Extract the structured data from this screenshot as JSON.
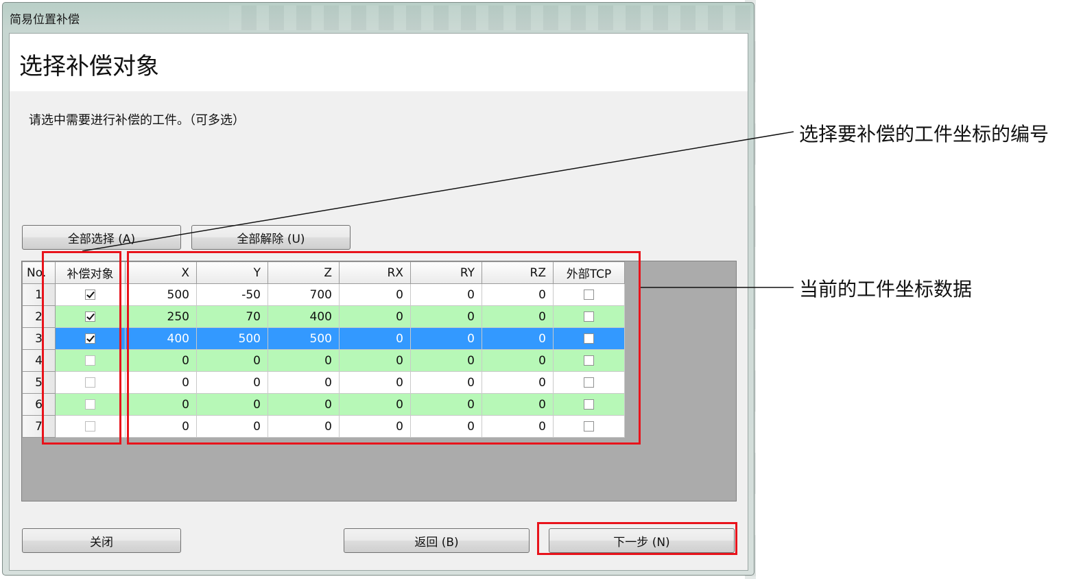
{
  "window": {
    "title": "简易位置补偿"
  },
  "page": {
    "heading": "选择补偿对象",
    "instruction": "请选中需要进行补偿的工件。（可多选）"
  },
  "buttons": {
    "select_all": "全部选择 (A)",
    "deselect_all": "全部解除 (U)",
    "close": "关闭",
    "back": "返回 (B)",
    "next": "下一步 (N)"
  },
  "grid": {
    "columns": [
      "No.",
      "补偿对象",
      "X",
      "Y",
      "Z",
      "RX",
      "RY",
      "RZ",
      "外部TCP"
    ],
    "rows": [
      {
        "no": "1",
        "target": true,
        "x": "500",
        "y": "-50",
        "z": "700",
        "rx": "0",
        "ry": "0",
        "rz": "0",
        "ext_tcp": false
      },
      {
        "no": "2",
        "target": true,
        "x": "250",
        "y": "70",
        "z": "400",
        "rx": "0",
        "ry": "0",
        "rz": "0",
        "ext_tcp": false
      },
      {
        "no": "3",
        "target": true,
        "x": "400",
        "y": "500",
        "z": "500",
        "rx": "0",
        "ry": "0",
        "rz": "0",
        "ext_tcp": false
      },
      {
        "no": "4",
        "target": false,
        "x": "0",
        "y": "0",
        "z": "0",
        "rx": "0",
        "ry": "0",
        "rz": "0",
        "ext_tcp": false
      },
      {
        "no": "5",
        "target": false,
        "x": "0",
        "y": "0",
        "z": "0",
        "rx": "0",
        "ry": "0",
        "rz": "0",
        "ext_tcp": false
      },
      {
        "no": "6",
        "target": false,
        "x": "0",
        "y": "0",
        "z": "0",
        "rx": "0",
        "ry": "0",
        "rz": "0",
        "ext_tcp": false
      },
      {
        "no": "7",
        "target": false,
        "x": "0",
        "y": "0",
        "z": "0",
        "rx": "0",
        "ry": "0",
        "rz": "0",
        "ext_tcp": false
      }
    ],
    "selected_row": 3
  },
  "annotations": {
    "select_number": "选择要补偿的工件坐标的编号",
    "current_data": "当前的工件坐标数据"
  },
  "colors": {
    "alt_row": "#b7f8b7",
    "selected_row": "#3399ff",
    "highlight_box": "#e8131b"
  }
}
